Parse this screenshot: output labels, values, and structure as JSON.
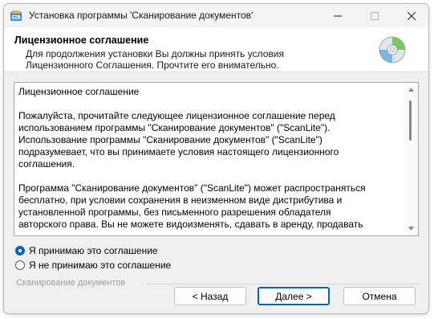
{
  "window": {
    "title": "Установка программы 'Сканирование документов'"
  },
  "header": {
    "title": "Лицензионное соглашение",
    "subtitle": "Для продолжения установки Вы должны принять условия\nЛицензионного Соглашения. Прочтите его внимательно.",
    "icon": "cd-disc-icon"
  },
  "license": {
    "text": "Лицензионное соглашение\n\nПожалуйста, прочитайте следующее лицензионное соглашение перед\nиспользованием программы \"Сканирование документов\" (\"ScanLite\").\nИспользование программы \"Сканирование документов\" (\"ScanLite\")\nподразумевает, что вы принимаете условия настоящего лицензионного\nсоглашения.\n\nПрограмма \"Сканирование документов\" (\"ScanLite\") может распространяться\nбесплатно, при условии сохранения в неизменном виде дистрибутива и\nустановленной программы, без письменного разрешения обладателя\nавторского права. Вы не можете видоизменять, сдавать в аренду, продавать"
  },
  "options": {
    "accept_label": "Я принимаю это соглашение",
    "decline_label": "Я не принимаю это соглашение",
    "selected": "accept"
  },
  "footer": {
    "brand": "Сканирование документов"
  },
  "buttons": {
    "back": "< Назад",
    "next": "Далее >",
    "cancel": "Отмена"
  },
  "colors": {
    "accent": "#0067c0"
  }
}
